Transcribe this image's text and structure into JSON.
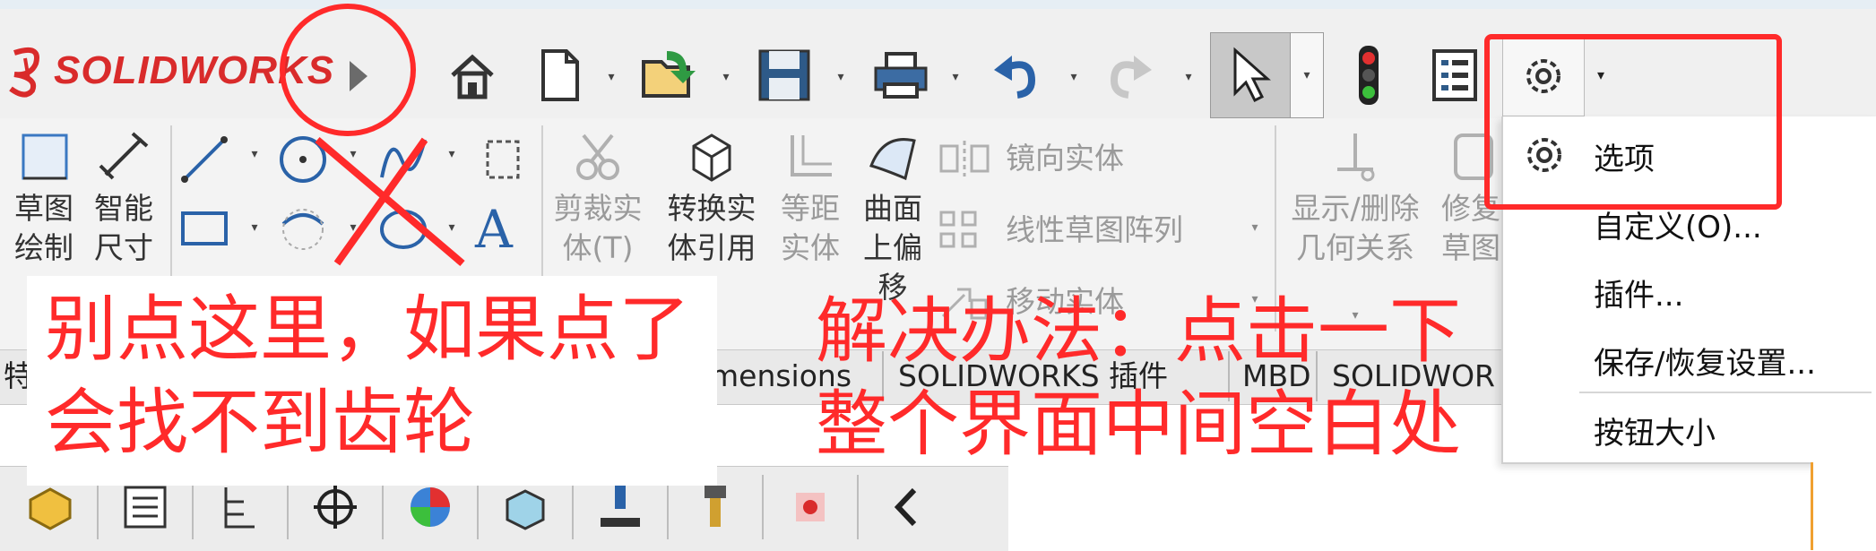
{
  "app": {
    "logo_text": "SOLIDWORKS",
    "logo_mark": "3DS"
  },
  "toolbar": {
    "icons": [
      "collapse-arrow-icon",
      "home-icon",
      "new-document-icon",
      "open-folder-icon",
      "save-icon",
      "print-icon",
      "undo-icon",
      "redo-icon",
      "select-cursor-icon",
      "rebuild-traffic-light-icon",
      "file-properties-icon",
      "options-gear-icon"
    ]
  },
  "ribbon": {
    "sketch_label": "草图\n绘制",
    "smart_dim_label": "智能\n尺寸",
    "trim_label": "剪裁实\n体(T)",
    "convert_label": "转换实\n体引用",
    "offset_label": "等距\n实体",
    "surface_offset_label": "曲面\n上偏\n移",
    "mirror_label": "镜向实体",
    "linear_pattern_label": "线性草图阵列",
    "move_label": "移动实体",
    "display_relations_label": "显示/删除\n几何关系",
    "repair_label": "修复\n草图"
  },
  "tabs": [
    "特",
    "mensions",
    "SOLIDWORKS 插件",
    "MBD",
    "SOLIDWOR"
  ],
  "menu": {
    "options": "选项",
    "customize": "自定义(O)...",
    "addins": "插件...",
    "save_restore": "保存/恢复设置...",
    "button_size": "按钮大小"
  },
  "annotations": {
    "warning_line1": "别点这里，如果点了",
    "warning_line2": "会找不到齿轮",
    "solution_line1": "解决办法：点击一下",
    "solution_line2": "整个界面中间空白处"
  },
  "colors": {
    "annotation_red": "#ff2a2a",
    "brand_red": "#d92b2b"
  }
}
